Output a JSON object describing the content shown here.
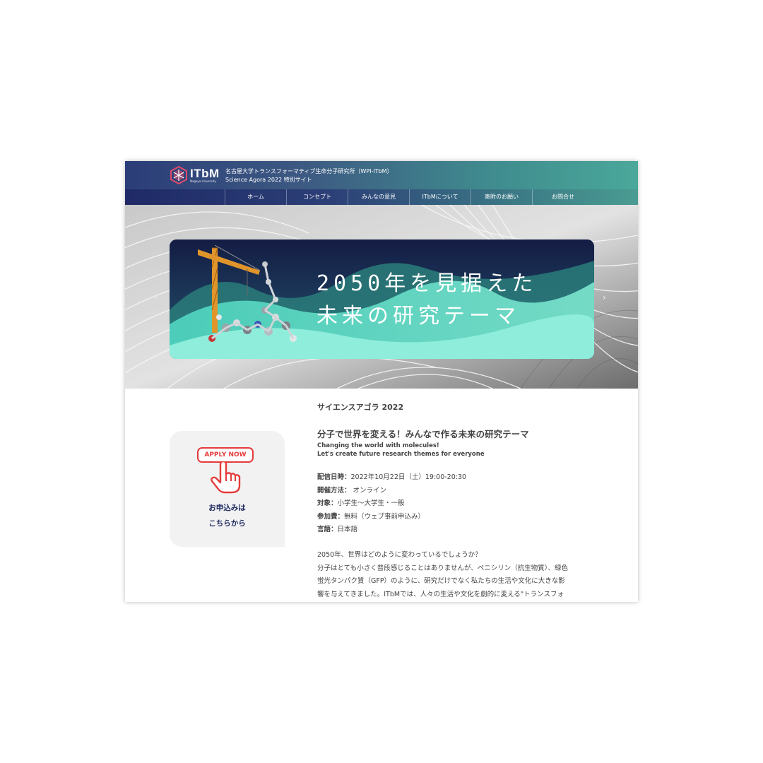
{
  "header": {
    "logo_text": "ITbM",
    "logo_subtext": "Nagoya University",
    "site_title_line1": "名古屋大学トランスフォーマティブ生命分子研究所（WPI-ITbM）",
    "site_title_line2": "Science Agora 2022 特別サイト"
  },
  "nav": {
    "items": [
      {
        "label": "ホーム"
      },
      {
        "label": "コンセプト"
      },
      {
        "label": "みんなの意見"
      },
      {
        "label": "ITbMについて"
      },
      {
        "label": "寄附のお願い"
      },
      {
        "label": "お問合せ"
      }
    ]
  },
  "hero": {
    "banner_line1": "2050年を見据えた",
    "banner_line2": "未来の研究テーマ",
    "prev_arrow": "‹",
    "next_arrow": "›"
  },
  "content": {
    "eyebrow": "サイエンスアゴラ 2022",
    "title": "分子で世界を変える！みんなで作る未来の研究テーマ",
    "subtitle_line1": "Changing the world with molecules!",
    "subtitle_line2": "Let's create future research themes for everyone",
    "details": [
      {
        "label": "配信日時：",
        "value": "2022年10月22日（土）19:00-20:30"
      },
      {
        "label": "開催方法：",
        "value": " オンライン"
      },
      {
        "label": "対象：",
        "value": "小学生〜大学生・一般"
      },
      {
        "label": "参加費：",
        "value": "無料（ウェブ事前申込み）"
      },
      {
        "label": "言語：",
        "value": "日本語"
      }
    ],
    "body_lines": [
      "2050年、世界はどのように変わっているでしょうか？",
      "分子はとても小さく普段感じることはありませんが、ペニシリン（抗生物質）、緑色",
      "蛍光タンパク質（GFP）のように、研究だけでなく私たちの生活や文化に大きな影",
      "響を与えてきました。ITbMでは、人々の生活や文化を劇的に変える\"トランスフォ"
    ]
  },
  "apply": {
    "badge": "APPLY NOW",
    "line1": "お申込みは",
    "line2": "こちらから"
  },
  "colors": {
    "accent_red": "#e53b3b",
    "navy": "#1e2a60",
    "teal": "#4aa89a"
  },
  "icons": [
    "itbm-logo-icon",
    "pointing-hand-icon"
  ]
}
